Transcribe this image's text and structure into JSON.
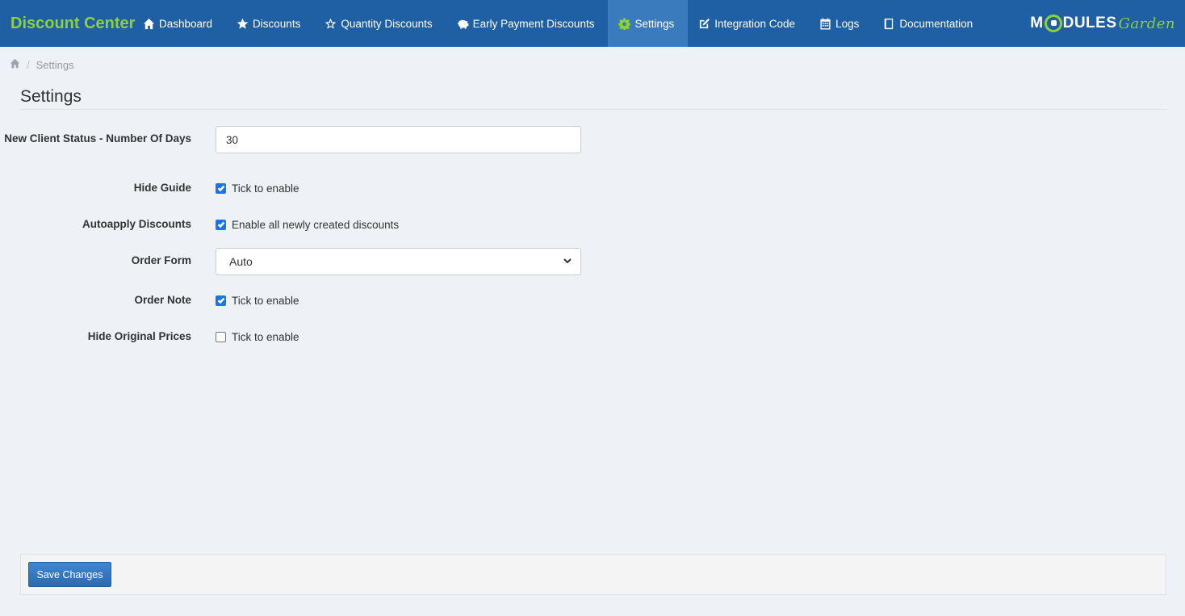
{
  "app": {
    "title": "Discount Center"
  },
  "nav": [
    {
      "label": "Dashboard",
      "icon": "home-icon"
    },
    {
      "label": "Discounts",
      "icon": "star-icon"
    },
    {
      "label": "Quantity Discounts",
      "icon": "star-outline-icon"
    },
    {
      "label": "Early Payment Discounts",
      "icon": "piggy-bank-icon"
    },
    {
      "label": "Settings",
      "icon": "gear-icon",
      "active": true
    },
    {
      "label": "Integration Code",
      "icon": "edit-icon"
    },
    {
      "label": "Logs",
      "icon": "calendar-icon"
    },
    {
      "label": "Documentation",
      "icon": "book-icon"
    }
  ],
  "logo": {
    "text_bold_1": "M",
    "text_bold_2": "DULES",
    "text_script": "Garden"
  },
  "breadcrumb": {
    "home_icon": "home-icon",
    "current": "Settings"
  },
  "page": {
    "title": "Settings"
  },
  "form": {
    "new_client_days": {
      "label": "New Client Status - Number Of Days",
      "value": "30"
    },
    "hide_guide": {
      "label": "Hide Guide",
      "text": "Tick to enable",
      "checked": true
    },
    "autoapply": {
      "label": "Autoapply Discounts",
      "text": "Enable all newly created discounts",
      "checked": true
    },
    "order_form": {
      "label": "Order Form",
      "selected": "Auto"
    },
    "order_note": {
      "label": "Order Note",
      "text": "Tick to enable",
      "checked": true
    },
    "hide_original_prices": {
      "label": "Hide Original Prices",
      "text": "Tick to enable",
      "checked": false
    }
  },
  "footer": {
    "save_label": "Save Changes"
  },
  "colors": {
    "navbar": "#1f5fa3",
    "active_tab": "#3a7bbd",
    "brand_green": "#8dd03c",
    "background": "#eef1f5",
    "checkbox": "#1a73e8"
  }
}
